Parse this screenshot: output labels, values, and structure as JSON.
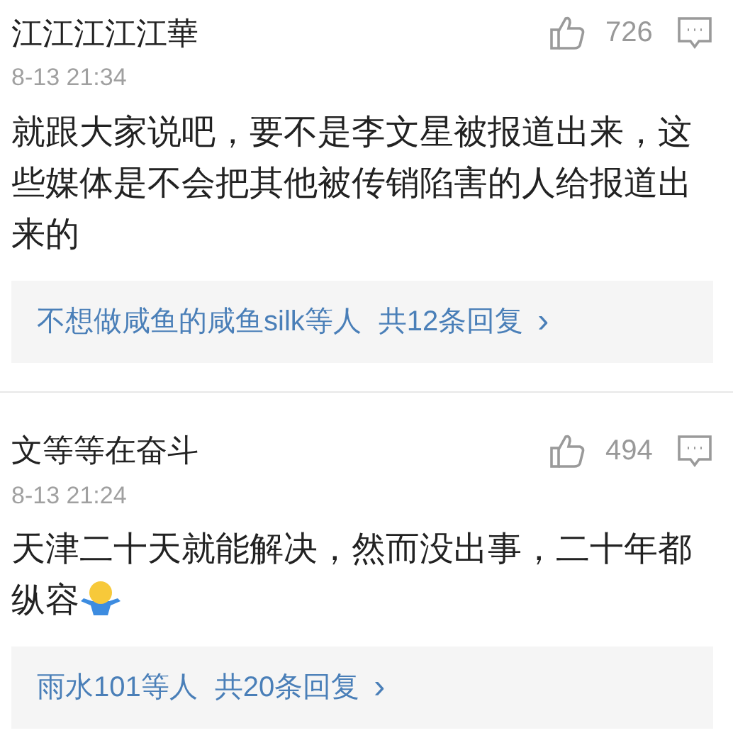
{
  "comments": [
    {
      "author": "江江江江江華",
      "likes": "726",
      "time": "8-13 21:34",
      "body": [
        {
          "kind": "text",
          "text": "就跟大家说吧，要不是李文星被报道出来，这些媒体是不会把其他被传销陷害的人给报道出来的"
        }
      ],
      "replies": {
        "users": "不想做咸鱼的咸鱼silk等人",
        "count": "共12条回复",
        "arrow": "›"
      }
    },
    {
      "author": "文等等在奋斗",
      "likes": "494",
      "time": "8-13 21:24",
      "body": [
        {
          "kind": "text",
          "text": "天津二十天就能解决，然而没出事，二十年都纵容"
        },
        {
          "kind": "emoji"
        }
      ],
      "replies": {
        "users": "雨水101等人",
        "count": "共20条回复",
        "arrow": "›"
      }
    }
  ]
}
